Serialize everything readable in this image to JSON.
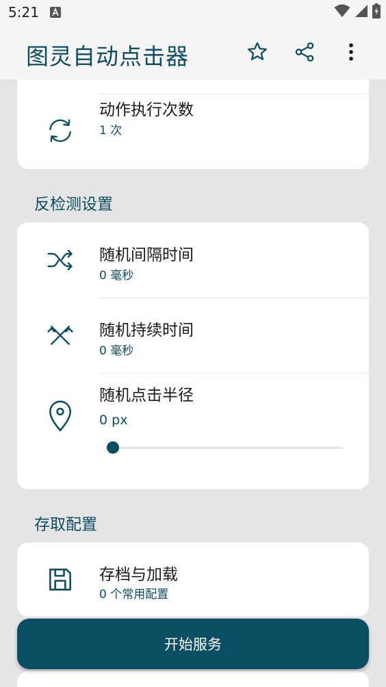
{
  "status_bar": {
    "time": "5:21"
  },
  "app_bar": {
    "title": "图灵自动点击器"
  },
  "top_card": {
    "repeat_title": "动作执行次数",
    "repeat_value": "1 次"
  },
  "anti_detect": {
    "section_title": "反检测设置",
    "items": [
      {
        "title": "随机间隔时间",
        "value": "0 毫秒"
      },
      {
        "title": "随机持续时间",
        "value": "0 毫秒"
      },
      {
        "title": "随机点击半径",
        "value": "0 px",
        "slider_value": 0
      }
    ]
  },
  "save_load": {
    "section_title": "存取配置",
    "title": "存档与加载",
    "value": "0 个常用配置"
  },
  "primary_button": {
    "label": "开始服务"
  },
  "colors": {
    "accent": "#0b4d63",
    "background": "#e5e5e5",
    "card": "#ffffff"
  }
}
